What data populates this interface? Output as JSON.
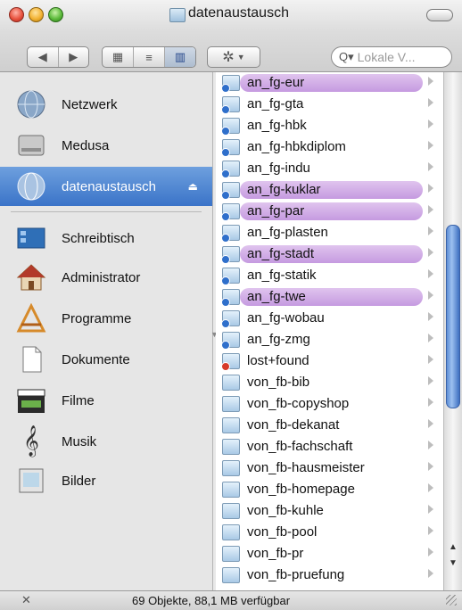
{
  "window": {
    "title": "datenaustausch"
  },
  "toolbar": {
    "back_icon": "back-arrow-icon",
    "forward_icon": "forward-arrow-icon",
    "view_icons": [
      "icon-view-icon",
      "list-view-icon",
      "column-view-icon"
    ],
    "action_icon": "gear-icon",
    "search_placeholder": "Lokale V..."
  },
  "sidebar": {
    "items": [
      {
        "label": "Netzwerk",
        "icon": "network-globe-icon"
      },
      {
        "label": "Medusa",
        "icon": "hard-drive-icon"
      },
      {
        "label": "datenaustausch",
        "icon": "network-volume-icon",
        "selected": true
      },
      {
        "label": "Schreibtisch",
        "icon": "desktop-icon"
      },
      {
        "label": "Administrator",
        "icon": "home-icon"
      },
      {
        "label": "Programme",
        "icon": "applications-icon"
      },
      {
        "label": "Dokumente",
        "icon": "documents-icon"
      },
      {
        "label": "Filme",
        "icon": "movies-clapperboard-icon"
      },
      {
        "label": "Musik",
        "icon": "music-note-icon"
      },
      {
        "label": "Bilder",
        "icon": "pictures-icon"
      }
    ]
  },
  "column": {
    "rows": [
      {
        "name": "an_fg-eur",
        "tagged": true,
        "badge": "blue"
      },
      {
        "name": "an_fg-gta",
        "tagged": false,
        "badge": "blue"
      },
      {
        "name": "an_fg-hbk",
        "tagged": false,
        "badge": "blue"
      },
      {
        "name": "an_fg-hbkdiplom",
        "tagged": false,
        "badge": "blue"
      },
      {
        "name": "an_fg-indu",
        "tagged": false,
        "badge": "blue"
      },
      {
        "name": "an_fg-kuklar",
        "tagged": true,
        "badge": "blue"
      },
      {
        "name": "an_fg-par",
        "tagged": true,
        "badge": "blue"
      },
      {
        "name": "an_fg-plasten",
        "tagged": false,
        "badge": "blue"
      },
      {
        "name": "an_fg-stadt",
        "tagged": true,
        "badge": "blue"
      },
      {
        "name": "an_fg-statik",
        "tagged": false,
        "badge": "blue"
      },
      {
        "name": "an_fg-twe",
        "tagged": true,
        "badge": "blue"
      },
      {
        "name": "an_fg-wobau",
        "tagged": false,
        "badge": "blue"
      },
      {
        "name": "an_fg-zmg",
        "tagged": false,
        "badge": "blue"
      },
      {
        "name": "lost+found",
        "tagged": false,
        "badge": "red"
      },
      {
        "name": "von_fb-bib",
        "tagged": false,
        "badge": ""
      },
      {
        "name": "von_fb-copyshop",
        "tagged": false,
        "badge": ""
      },
      {
        "name": "von_fb-dekanat",
        "tagged": false,
        "badge": ""
      },
      {
        "name": "von_fb-fachschaft",
        "tagged": false,
        "badge": ""
      },
      {
        "name": "von_fb-hausmeister",
        "tagged": false,
        "badge": ""
      },
      {
        "name": "von_fb-homepage",
        "tagged": false,
        "badge": ""
      },
      {
        "name": "von_fb-kuhle",
        "tagged": false,
        "badge": ""
      },
      {
        "name": "von_fb-pool",
        "tagged": false,
        "badge": ""
      },
      {
        "name": "von_fb-pr",
        "tagged": false,
        "badge": ""
      },
      {
        "name": "von_fb-pruefung",
        "tagged": false,
        "badge": ""
      }
    ]
  },
  "statusbar": {
    "text": "69 Objekte, 88,1 MB verfügbar"
  },
  "colors": {
    "selection": "#3a73c8",
    "label_tag": "#c59ae0",
    "scroll_thumb": "#5e8fd6"
  }
}
